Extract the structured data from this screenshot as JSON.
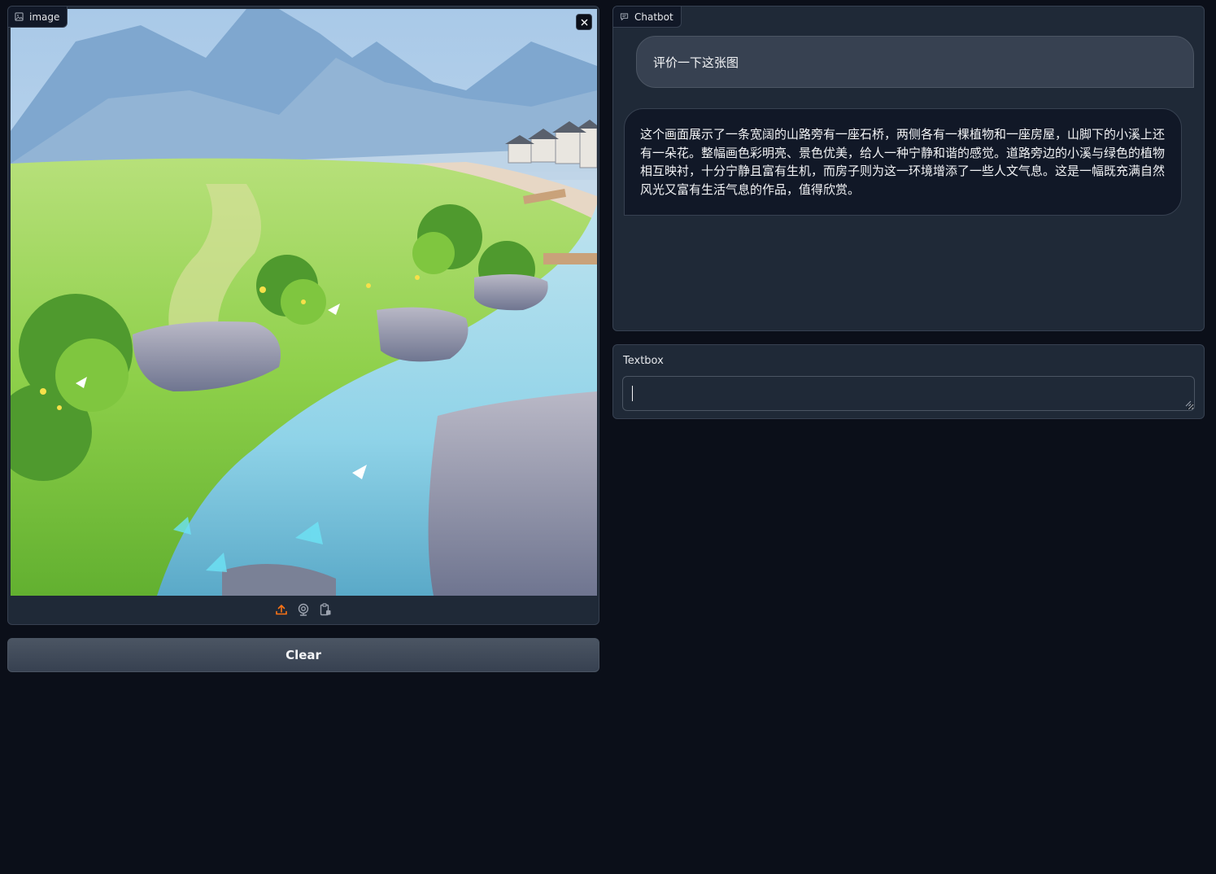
{
  "image_block": {
    "label": "image",
    "label_icon": "image-icon",
    "close_icon": "close-icon",
    "toolbar": [
      {
        "name": "upload",
        "icon": "upload-icon",
        "color": "#f97316"
      },
      {
        "name": "webcam",
        "icon": "webcam-icon",
        "color": "#9ca3af"
      },
      {
        "name": "clipboard",
        "icon": "clipboard-icon",
        "color": "#9ca3af"
      }
    ]
  },
  "clear_button": {
    "label": "Clear"
  },
  "chatbot": {
    "label": "Chatbot",
    "label_icon": "chat-icon",
    "messages": [
      {
        "role": "user",
        "text": "评价一下这张图"
      },
      {
        "role": "bot",
        "text": "这个画面展示了一条宽阔的山路旁有一座石桥，两侧各有一棵植物和一座房屋，山脚下的小溪上还有一朵花。整幅画色彩明亮、景色优美，给人一种宁静和谐的感觉。道路旁边的小溪与绿色的植物相互映衬，十分宁静且富有生机，而房子则为这一环境增添了一些人文气息。这是一幅既充满自然风光又富有生活气息的作品，值得欣赏。"
      }
    ]
  },
  "textbox": {
    "label": "Textbox",
    "value": "",
    "placeholder": ""
  },
  "colors": {
    "background": "#0b0f19",
    "panel": "#1f2937",
    "border": "#374151",
    "accent": "#f97316"
  }
}
